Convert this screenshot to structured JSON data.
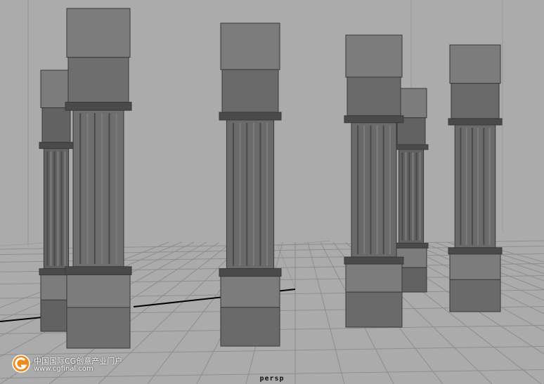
{
  "viewport": {
    "camera_name": "persp",
    "background": "#ababab",
    "object_color": "#6a6a6a",
    "grid_color": "#8e8e8e",
    "axis_color": "#000000"
  },
  "scene": {
    "object_type": "column",
    "column_count": 6
  },
  "watermark": {
    "title": "中国国际CG创意产业门户",
    "url": "www.cgfinal.com",
    "logo_icon": "cgfinal-logo-icon"
  }
}
